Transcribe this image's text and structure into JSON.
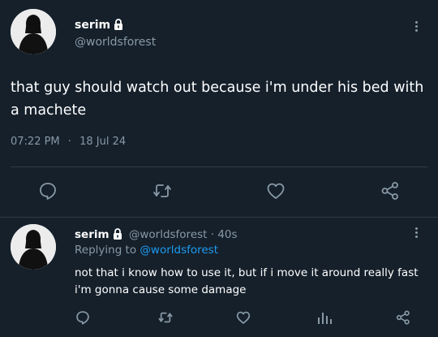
{
  "main_tweet": {
    "display_name": "serim",
    "handle": "@worldsforest",
    "text": "that guy should watch out because i'm under his bed with a machete",
    "time": "07:22 PM",
    "separator": "·",
    "date": "18 Jul 24",
    "icons": {
      "lock": "lock-icon",
      "more": "more-options-icon",
      "reply": "reply-icon",
      "retweet": "retweet-icon",
      "like": "heart-icon",
      "share": "share-icon"
    }
  },
  "reply_tweet": {
    "display_name": "serim",
    "handle": "@worldsforest",
    "age": "· 40s",
    "replying_to_prefix": "Replying to",
    "replying_to_handle": "@worldsforest",
    "text": "not that i know how to use it, but if i move it around really fast i'm gonna cause some damage",
    "icons": {
      "reply": "reply-icon",
      "retweet": "retweet-icon",
      "like": "heart-icon",
      "analytics": "analytics-icon",
      "share": "share-icon"
    }
  },
  "colors": {
    "background": "#15202b",
    "text": "#ffffff",
    "muted": "#8899a6",
    "link": "#1d9bf0",
    "divider": "#2f3b46"
  }
}
